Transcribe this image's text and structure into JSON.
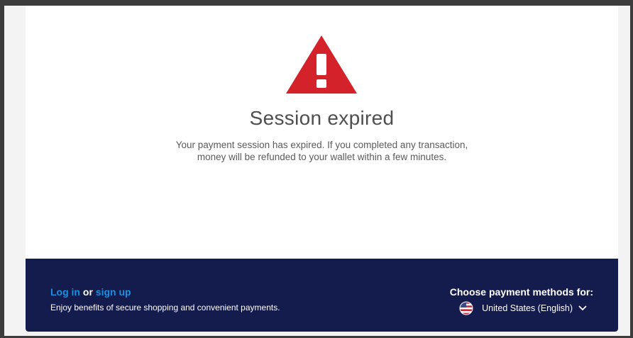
{
  "status": {
    "title": "Session expired",
    "message": "Your payment session has expired. If you completed any transaction, money will be refunded to your wallet within a few minutes.",
    "icon": "warning-triangle-icon",
    "icon_color": "#d3222a"
  },
  "footer": {
    "login_label": "Log in",
    "or_label": "or",
    "signup_label": "sign up",
    "benefits_text": "Enjoy benefits of secure shopping and convenient payments.",
    "choose_label": "Choose payment methods for:",
    "locale_label": "United States (English)",
    "flag_icon": "us-flag-icon",
    "background_color": "#141b4d",
    "link_color": "#1a90e0"
  }
}
